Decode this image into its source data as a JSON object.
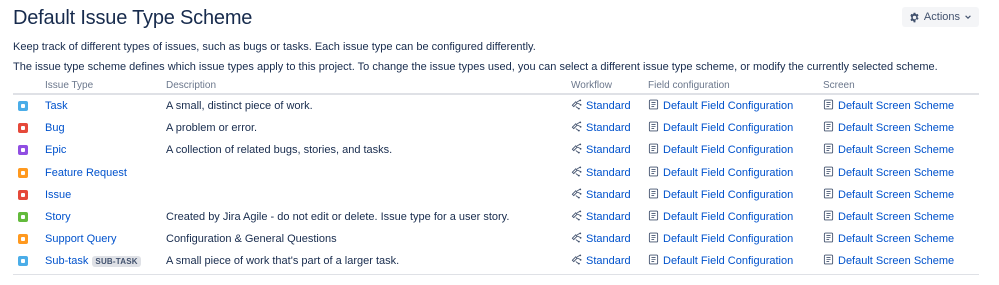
{
  "header": {
    "title": "Default Issue Type Scheme",
    "actions_label": "Actions"
  },
  "intro": {
    "line1": "Keep track of different types of issues, such as bugs or tasks. Each issue type can be configured differently.",
    "line2": "The issue type scheme defines which issue types apply to this project. To change the issue types used, you can select a different issue type scheme, or modify the currently selected scheme."
  },
  "table": {
    "columns": {
      "issue_type": "Issue Type",
      "description": "Description",
      "workflow": "Workflow",
      "field_configuration": "Field configuration",
      "screen": "Screen"
    },
    "rows": [
      {
        "name": "Task",
        "lozenge": "",
        "description": "A small, distinct piece of work.",
        "workflow": "Standard",
        "field_configuration": "Default Field Configuration",
        "screen": "Default Screen Scheme",
        "icon": "task-icon",
        "icon_color": "#4bade8"
      },
      {
        "name": "Bug",
        "lozenge": "",
        "description": "A problem or error.",
        "workflow": "Standard",
        "field_configuration": "Default Field Configuration",
        "screen": "Default Screen Scheme",
        "icon": "bug-icon",
        "icon_color": "#e5493a"
      },
      {
        "name": "Epic",
        "lozenge": "",
        "description": "A collection of related bugs, stories, and tasks.",
        "workflow": "Standard",
        "field_configuration": "Default Field Configuration",
        "screen": "Default Screen Scheme",
        "icon": "epic-icon",
        "icon_color": "#904ee2"
      },
      {
        "name": "Feature Request",
        "lozenge": "",
        "description": "",
        "workflow": "Standard",
        "field_configuration": "Default Field Configuration",
        "screen": "Default Screen Scheme",
        "icon": "feature-request-icon",
        "icon_color": "#ff991f"
      },
      {
        "name": "Issue",
        "lozenge": "",
        "description": "",
        "workflow": "Standard",
        "field_configuration": "Default Field Configuration",
        "screen": "Default Screen Scheme",
        "icon": "issue-icon",
        "icon_color": "#e5493a"
      },
      {
        "name": "Story",
        "lozenge": "",
        "description": "Created by Jira Agile - do not edit or delete. Issue type for a user story.",
        "workflow": "Standard",
        "field_configuration": "Default Field Configuration",
        "screen": "Default Screen Scheme",
        "icon": "story-icon",
        "icon_color": "#63ba3c"
      },
      {
        "name": "Support Query",
        "lozenge": "",
        "description": "Configuration & General Questions",
        "workflow": "Standard",
        "field_configuration": "Default Field Configuration",
        "screen": "Default Screen Scheme",
        "icon": "support-query-icon",
        "icon_color": "#ff991f"
      },
      {
        "name": "Sub-task",
        "lozenge": "SUB-TASK",
        "description": "A small piece of work that's part of a larger task.",
        "workflow": "Standard",
        "field_configuration": "Default Field Configuration",
        "screen": "Default Screen Scheme",
        "icon": "subtask-icon",
        "icon_color": "#4bade8"
      }
    ]
  },
  "colors": {
    "link": "#0052cc",
    "text": "#172b4d",
    "muted": "#6b778c",
    "divider": "#dfe1e6"
  }
}
